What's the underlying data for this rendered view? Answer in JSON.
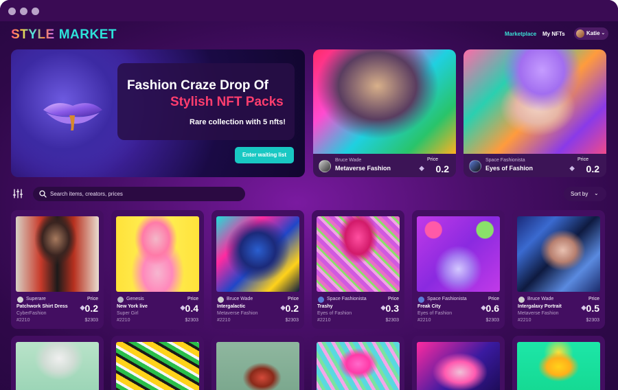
{
  "brand": {
    "logo_part1": "STYLE",
    "logo_part2": "MARKET"
  },
  "nav": {
    "marketplace": "Marketplace",
    "my_nfts": "My NFTs",
    "user_name": "Katie"
  },
  "hero": {
    "title_line1": "Fashion Craze Drop Of",
    "title_line2": "Stylish NFT Packs",
    "subtitle": "Rare collection with 5 nfts!",
    "cta": "Enter waiting list",
    "accent_color": "#ff3d6e"
  },
  "featured": [
    {
      "creator": "Bruce Wade",
      "title": "Metaverse Fashion",
      "price_label": "Price",
      "price": "0.2",
      "icon": "eth-icon"
    },
    {
      "creator": "Space Fashionista",
      "title": "Eyes of Fashion",
      "price_label": "Price",
      "price": "0.2",
      "icon": "eth-icon"
    }
  ],
  "search": {
    "placeholder": "Search items, creators, prices"
  },
  "sort": {
    "label": "Sort by"
  },
  "cards": [
    {
      "creator": "Superare",
      "title": "Patchwork Shirt Dress",
      "collection": "CyberFashion",
      "id": "#2210",
      "price_label": "Price",
      "price": "0.2",
      "usd": "$2303"
    },
    {
      "creator": "Genesis",
      "title": "New York live",
      "collection": "Super Girl",
      "id": "#2210",
      "price_label": "Price",
      "price": "0.4",
      "usd": "$2303"
    },
    {
      "creator": "Bruce Wade",
      "title": "Intergalactic",
      "collection": "Metaverse Fashion",
      "id": "#2210",
      "price_label": "Price",
      "price": "0.2",
      "usd": "$2303"
    },
    {
      "creator": "Space Fashionista",
      "title": "Trashy",
      "collection": "Eyes of Fashion",
      "id": "#2210",
      "price_label": "Price",
      "price": "0.3",
      "usd": "$2303"
    },
    {
      "creator": "Space Fashionista",
      "title": "Freak City",
      "collection": "Eyes of Fashion",
      "id": "#2210",
      "price_label": "Price",
      "price": "0.6",
      "usd": "$2303"
    },
    {
      "creator": "Bruce Wade",
      "title": "Intergalaxy Portrait",
      "collection": "Metaverse Fashion",
      "id": "#2210",
      "price_label": "Price",
      "price": "0.5",
      "usd": "$2303"
    }
  ],
  "colors": {
    "accent_teal": "#19c8c3",
    "background": "#4a0f6a",
    "card_bg": "#430e61"
  }
}
